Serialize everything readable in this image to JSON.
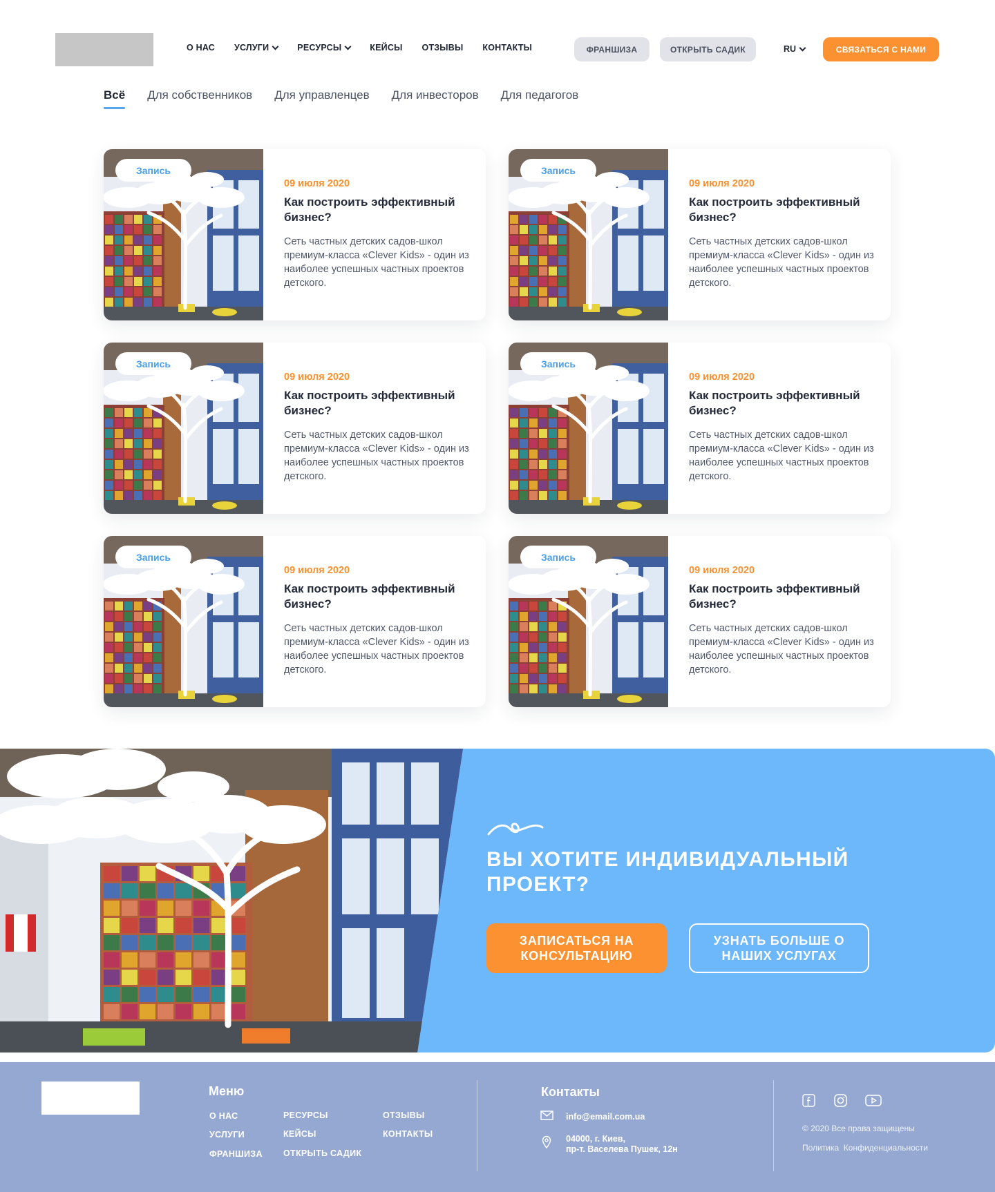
{
  "header": {
    "nav": [
      {
        "label": "О НАС",
        "dropdown": false
      },
      {
        "label": "УСЛУГИ",
        "dropdown": true
      },
      {
        "label": "РЕСУРСЫ",
        "dropdown": true
      },
      {
        "label": "КЕЙСЫ",
        "dropdown": false
      },
      {
        "label": "ОТЗЫВЫ",
        "dropdown": false
      },
      {
        "label": "КОНТАКТЫ",
        "dropdown": false
      }
    ],
    "franchise_label": "ФРАНШИЗА",
    "open_garden_label": "ОТКРЫТЬ САДИК",
    "language": "RU",
    "contact_label": "СВЯЗАТЬСЯ С НАМИ"
  },
  "filters": {
    "tabs": [
      "Всё",
      "Для собственников",
      "Для управленцев",
      "Для инвесторов",
      "Для педагогов"
    ],
    "active_index": 0
  },
  "cards": [
    {
      "badge": "Запись",
      "date": "09 июля 2020",
      "title": "Как построить эффективный бизнес?",
      "text": "Сеть частных детских садов-школ премиум-класса «Clever Kids» - один из наиболее успешных частных проектов детского."
    },
    {
      "badge": "Запись",
      "date": "09 июля 2020",
      "title": "Как построить эффективный бизнес?",
      "text": "Сеть частных детских садов-школ премиум-класса «Clever Kids» - один из наиболее успешных частных проектов детского."
    },
    {
      "badge": "Запись",
      "date": "09 июля 2020",
      "title": "Как построить эффективный бизнес?",
      "text": "Сеть частных детских садов-школ премиум-класса «Clever Kids» - один из наиболее успешных частных проектов детского."
    },
    {
      "badge": "Запись",
      "date": "09 июля 2020",
      "title": "Как построить эффективный бизнес?",
      "text": "Сеть частных детских садов-школ премиум-класса «Clever Kids» - один из наиболее успешных частных проектов детского."
    },
    {
      "badge": "Запись",
      "date": "09 июля 2020",
      "title": "Как построить эффективный бизнес?",
      "text": "Сеть частных детских садов-школ премиум-класса «Clever Kids» - один из наиболее успешных частных проектов детского."
    },
    {
      "badge": "Запись",
      "date": "09 июля 2020",
      "title": "Как построить эффективный бизнес?",
      "text": "Сеть частных детских садов-школ премиум-класса «Clever Kids» - один из наиболее успешных частных проектов детского."
    }
  ],
  "banner": {
    "title": "ВЫ ХОТИТЕ ИНДИВИДУАЛЬНЫЙ ПРОЕКТ?",
    "consult_button": "ЗАПИСАТЬСЯ НА КОНСУЛЬТАЦИЮ",
    "more_button": "УЗНАТЬ БОЛЬШЕ О НАШИХ УСЛУГАХ"
  },
  "footer": {
    "menu_title": "Меню",
    "menu": [
      "О НАС",
      "УСЛУГИ",
      "ФРАНШИЗА",
      "РЕСУРСЫ",
      "КЕЙСЫ",
      "ОТКРЫТЬ САДИК",
      "ОТЗЫВЫ",
      "КОНТАКТЫ"
    ],
    "contacts_title": "Контакты",
    "email": "info@email.com.ua",
    "address_line1": "04000, г. Киев,",
    "address_line2": "пр-т. Васелева Пушек, 12н",
    "social_icons": [
      "facebook-icon",
      "instagram-icon",
      "youtube-icon"
    ],
    "copyright": "© 2020 Все права защищены",
    "privacy": "Политика  Конфиденциальности"
  },
  "colors": {
    "accent_orange": "#fb9130",
    "accent_blue": "#6db7fb",
    "tab_underline": "#5aa6ea",
    "footer_bg": "#95a8d2",
    "date_orange": "#f8902e"
  }
}
